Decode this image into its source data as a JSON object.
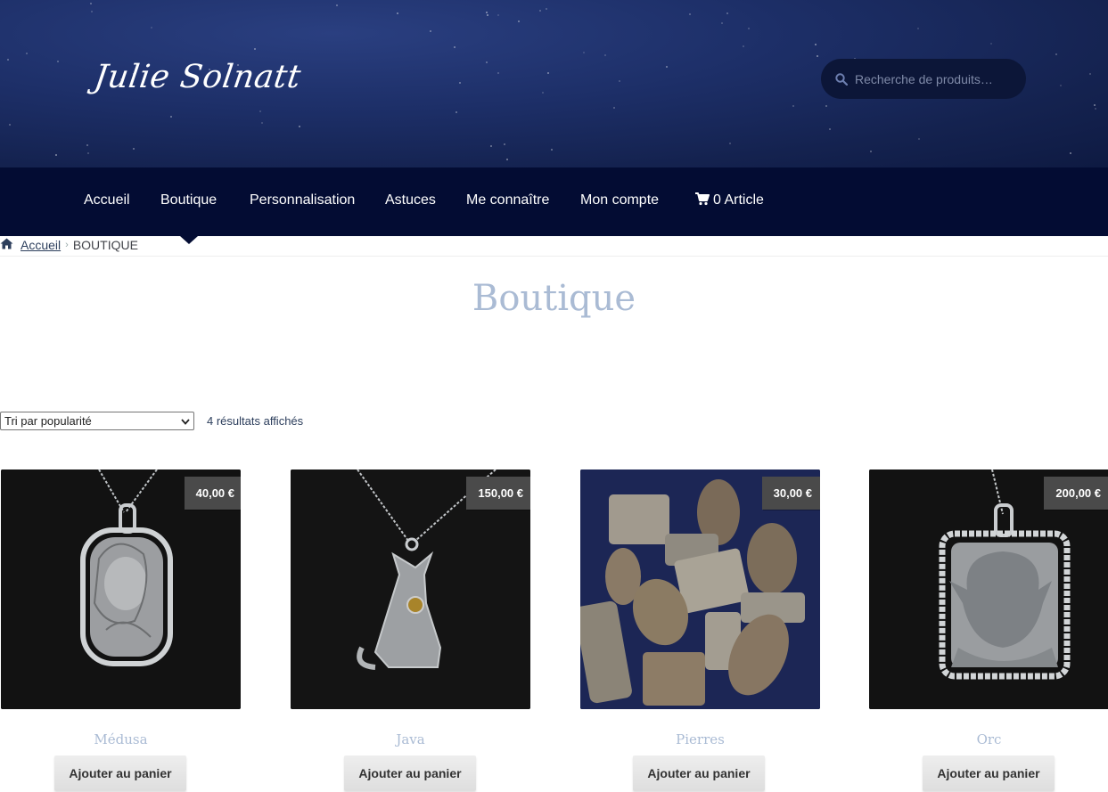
{
  "site": {
    "logo": "Julie Solnatt"
  },
  "search": {
    "placeholder": "Recherche de produits…"
  },
  "nav": {
    "items": [
      "Accueil",
      "Boutique",
      "Personnalisation",
      "Astuces",
      "Me connaître",
      "Mon compte"
    ],
    "cart_label": "0 Article",
    "active": "Boutique"
  },
  "breadcrumb": {
    "home": "Accueil",
    "current": "BOUTIQUE"
  },
  "page": {
    "title": "Boutique"
  },
  "sorting": {
    "selected": "Tri par popularité",
    "result_count": "4 résultats affichés"
  },
  "products": [
    {
      "name": "Médusa",
      "price": "40,00 €",
      "button": "Ajouter au panier",
      "image": "silver-medusa-pendant"
    },
    {
      "name": "Java",
      "price": "150,00 €",
      "button": "Ajouter au panier",
      "image": "silver-fox-pendant"
    },
    {
      "name": "Pierres",
      "price": "30,00 €",
      "button": "Ajouter au panier",
      "image": "fossil-coral-cabochons"
    },
    {
      "name": "Orc",
      "price": "200,00 €",
      "button": "Ajouter au panier",
      "image": "silver-orc-pendant"
    }
  ],
  "colors": {
    "header_bg": "#1d2f68",
    "nav_bg": "#030c33",
    "title": "#aabbd4",
    "price_badge": "#4a4a4a"
  }
}
